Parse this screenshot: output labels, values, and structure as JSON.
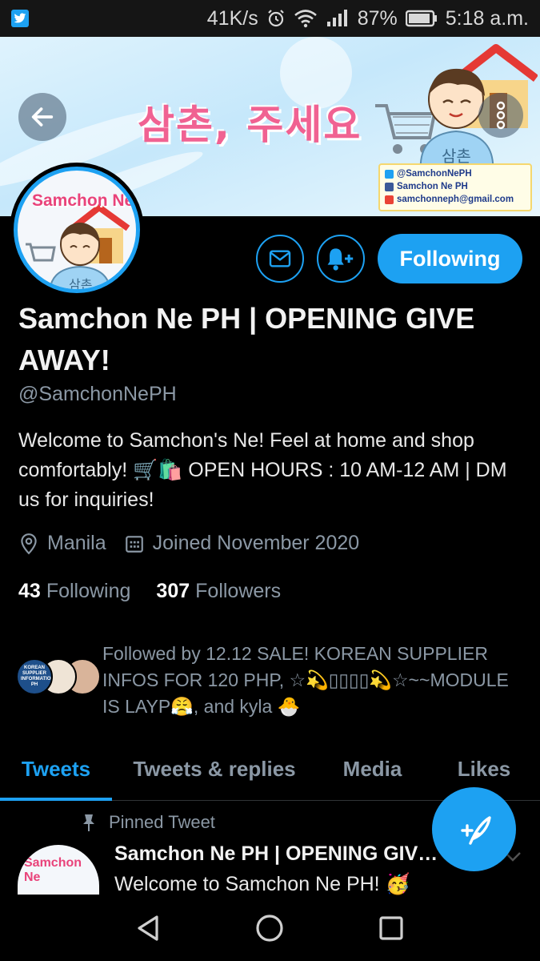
{
  "status_bar": {
    "app_icon": "twitter-icon",
    "speed": "41K/s",
    "battery": "87%",
    "time": "5:18 a.m."
  },
  "banner": {
    "title": "삼촌, 주세요",
    "shirt_text": "삼촌",
    "contact": {
      "twitter": "@SamchonNePH",
      "facebook": "Samchon Ne PH",
      "email": "samchonneph@gmail.com"
    }
  },
  "avatar": {
    "label": "Samchon Ne",
    "shirt_text": "삼촌"
  },
  "actions": {
    "message_icon": "envelope-icon",
    "notify_icon": "bell-plus-icon",
    "follow_label": "Following"
  },
  "profile": {
    "name": "Samchon Ne PH | OPENING GIVE AWAY!",
    "handle": "@SamchonNePH",
    "bio": "Welcome to Samchon's Ne! Feel at home and shop comfortably! 🛒🛍️ OPEN HOURS : 10 AM-12 AM | DM us for inquiries!",
    "location": "Manila",
    "joined": "Joined November 2020",
    "following_count": "43",
    "following_label": "Following",
    "followers_count": "307",
    "followers_label": "Followers"
  },
  "followed_by": {
    "text": "Followed by 12.12 SALE! KOREAN SUPPLIER INFOS FOR 120 PHP, ☆💫▯▯▯▯💫☆~~MODULE IS LAYP😤, and kyla 🐣",
    "first_avatar_label": "KOREAN SUPPLIER INFORMATION PH"
  },
  "tabs": [
    {
      "label": "Tweets",
      "active": true
    },
    {
      "label": "Tweets & replies",
      "active": false
    },
    {
      "label": "Media",
      "active": false
    },
    {
      "label": "Likes",
      "active": false
    }
  ],
  "pinned_tweet": {
    "label": "Pinned Tweet",
    "author": "Samchon Ne PH | OPENING GIVE AWAY!",
    "text": "Welcome to Samchon Ne PH! 🥳",
    "avatar_label": "Samchon Ne"
  },
  "colors": {
    "accent": "#1da1f2",
    "background": "#000000",
    "muted": "#8b98a5",
    "banner_title": "#f06292"
  }
}
